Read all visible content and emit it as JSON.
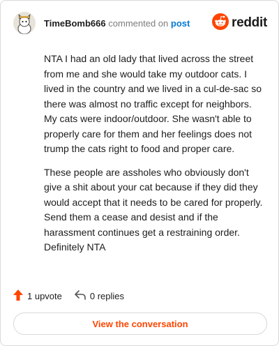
{
  "comment": {
    "username": "TimeBomb666",
    "action_text": "commented on",
    "post_link": "post",
    "brand": "reddit",
    "paragraphs": [
      "NTA I had an old lady that lived across the street from me and she would take my outdoor cats. I lived in the country and we lived in a cul-de-sac so there was almost no traffic except for neighbors. My cats were indoor/outdoor. She wasn't able to properly care for them and her feelings does not trump the cats right to food and proper care.",
      "These people are assholes who obviously don't give a shit about your cat because if they did they would accept that it needs to be cared for properly. Send them a cease and desist and if the harassment continues get a restraining order. Definitely NTA"
    ],
    "upvotes_label": "1 upvote",
    "replies_label": "0 replies",
    "cta_label": "View the conversation"
  },
  "colors": {
    "accent": "#ff4500",
    "link": "#0079d3",
    "muted": "#7c7c7c"
  },
  "icons": [
    "avatar",
    "reddit-logo-icon",
    "upvote-arrow-icon",
    "reply-icon"
  ]
}
